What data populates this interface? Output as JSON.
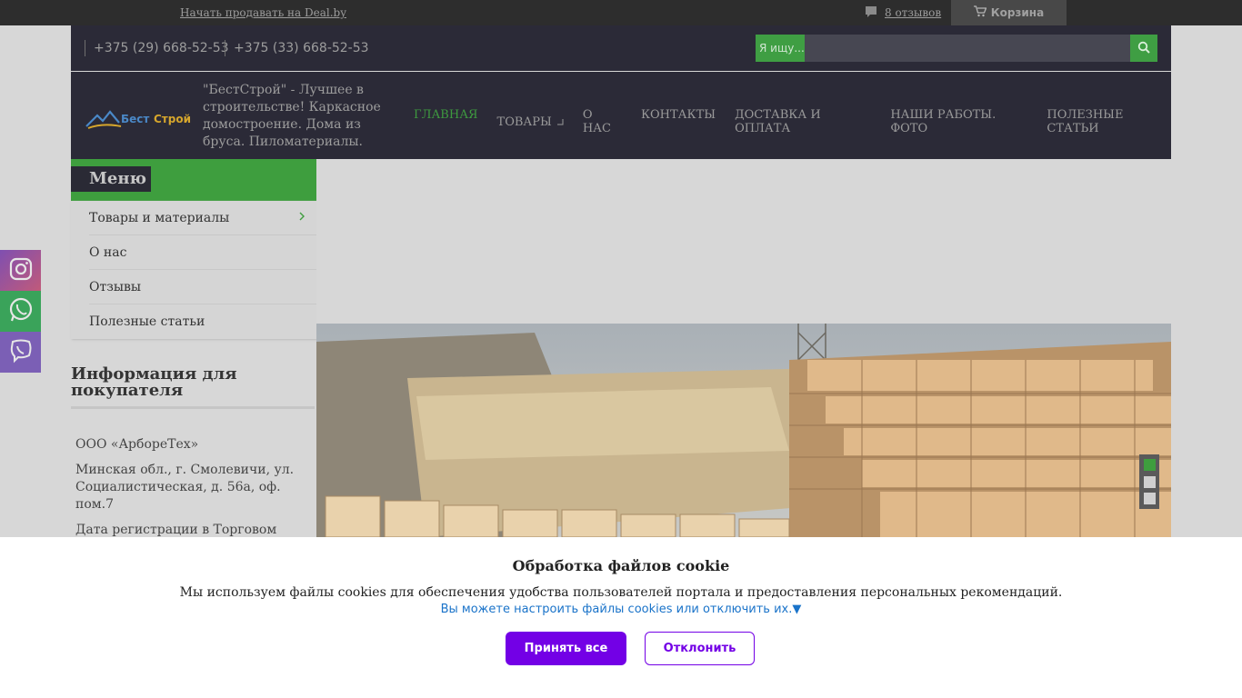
{
  "topbar": {
    "sell_link": "Начать продавать на Deal.by",
    "reviews_link": "8 отзывов",
    "cart_label": "Корзина"
  },
  "contacts": {
    "phone1": "+375 (29) 668-52-53",
    "phone2": "+375 (33) 668-52-53"
  },
  "search": {
    "label": "Я ищу...",
    "placeholder": ""
  },
  "header": {
    "tagline": "\"БестСтрой\" - Лучшее в строительстве! Каркасное домостроение. Дома из бруса. Пиломатериалы.",
    "logo_text": "БестСтрой"
  },
  "nav": {
    "items": [
      "ГЛАВНАЯ",
      "ТОВАРЫ",
      "О НАС",
      "КОНТАКТЫ",
      "ДОСТАВКА И ОПЛАТА",
      "НАШИ РАБОТЫ. ФОТО",
      "ПОЛЕЗНЫЕ СТАТЬИ"
    ],
    "active": "ГЛАВНАЯ"
  },
  "sidebar": {
    "menu_title": "Меню",
    "items": [
      {
        "label": "Товары и материалы"
      },
      {
        "label": "О нас"
      },
      {
        "label": "Отзывы"
      },
      {
        "label": "Полезные статьи"
      }
    ],
    "info_title": "Информация для покупателя",
    "info": {
      "company": "ООО «АрбореТех»",
      "address": "Минская обл., г. Смолевичи, ул. Социалистическая, д. 56а, оф. пом.7",
      "registration": "Дата регистрации в Торговом реестре/Реестре бытовых услуг: Не"
    }
  },
  "slider": {
    "slide_count": 3,
    "active_index": 0
  },
  "socials": [
    "instagram-icon",
    "whatsapp-icon",
    "viber-icon"
  ],
  "colors": {
    "accent": "#3e9e3e",
    "header_bg": "#2b2a37",
    "cookie_button": "#7300e6"
  },
  "cookie": {
    "title": "Обработка файлов cookie",
    "text": "Мы используем файлы cookies для обеспечения удобства пользователей портала и предоставления персональных рекомендаций.",
    "settings_link": "Вы можете настроить файлы cookies или отключить их.▼",
    "accept_label": "Принять все",
    "decline_label": "Отклонить"
  }
}
